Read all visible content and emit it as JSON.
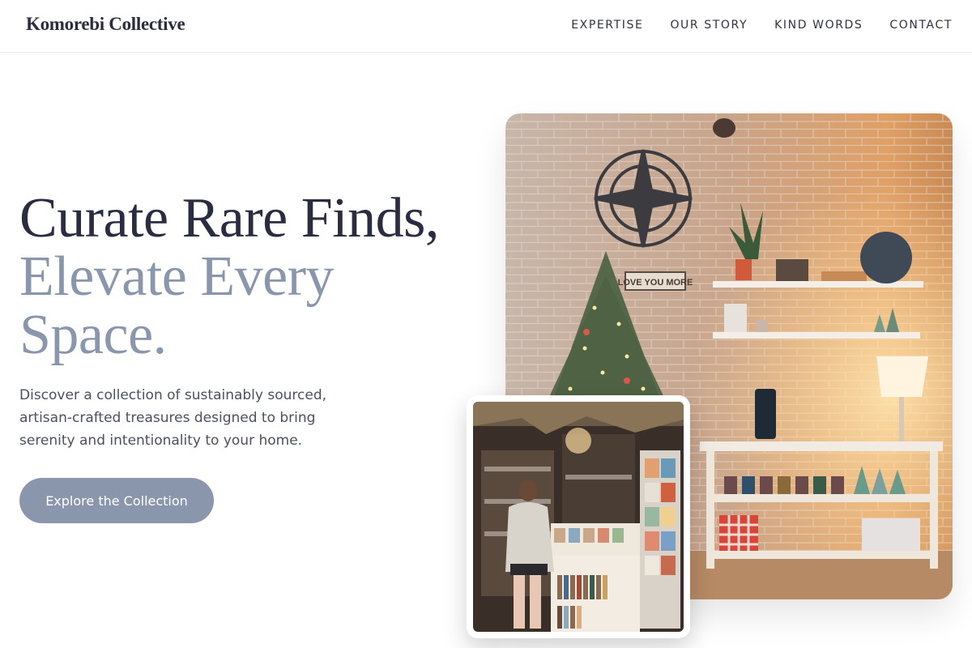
{
  "header": {
    "brand": "Komorebi Collective",
    "nav": [
      {
        "label": "EXPERTISE"
      },
      {
        "label": "OUR STORY"
      },
      {
        "label": "KIND WORDS"
      },
      {
        "label": "CONTACT"
      }
    ]
  },
  "hero": {
    "title_line1": "Curate Rare Finds,",
    "title_line2": "Elevate Every Space.",
    "description": "Discover a collection of sustainably sourced, artisan-crafted treasures designed to bring serenity and intentionality to your home.",
    "cta_label": "Explore the Collection"
  },
  "images": {
    "main_sign_text": "LOVE YOU MORE",
    "main_alt": "Shop interior with brick wall, Christmas tree, shelves and lamp",
    "inset_alt": "Person browsing cards in a cozy bookshop"
  },
  "colors": {
    "primary_text": "#2a2c40",
    "accent": "#8a96ac",
    "body_text": "#4b5060"
  }
}
